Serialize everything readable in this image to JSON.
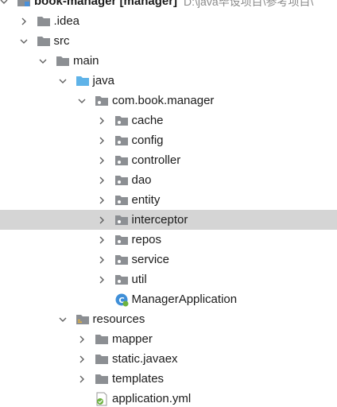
{
  "tree": {
    "rows": [
      {
        "label": "book-manager [manager]",
        "suffix": "D:\\java毕设项目\\参考项目\\",
        "level": 0,
        "arrow": "down",
        "icon": "module-icon",
        "bold": true
      },
      {
        "label": ".idea",
        "level": 1,
        "arrow": "right",
        "icon": "folder-icon"
      },
      {
        "label": "src",
        "level": 1,
        "arrow": "down",
        "icon": "folder-icon"
      },
      {
        "label": "main",
        "level": 2,
        "arrow": "down",
        "icon": "folder-icon"
      },
      {
        "label": "java",
        "level": 3,
        "arrow": "down",
        "icon": "source-folder-icon"
      },
      {
        "label": "com.book.manager",
        "level": 4,
        "arrow": "down",
        "icon": "package-icon"
      },
      {
        "label": "cache",
        "level": 5,
        "arrow": "right",
        "icon": "package-icon"
      },
      {
        "label": "config",
        "level": 5,
        "arrow": "right",
        "icon": "package-icon"
      },
      {
        "label": "controller",
        "level": 5,
        "arrow": "right",
        "icon": "package-icon"
      },
      {
        "label": "dao",
        "level": 5,
        "arrow": "right",
        "icon": "package-icon"
      },
      {
        "label": "entity",
        "level": 5,
        "arrow": "right",
        "icon": "package-icon"
      },
      {
        "label": "interceptor",
        "level": 5,
        "arrow": "right",
        "icon": "package-icon",
        "selected": true
      },
      {
        "label": "repos",
        "level": 5,
        "arrow": "right",
        "icon": "package-icon"
      },
      {
        "label": "service",
        "level": 5,
        "arrow": "right",
        "icon": "package-icon"
      },
      {
        "label": "util",
        "level": 5,
        "arrow": "right",
        "icon": "package-icon"
      },
      {
        "label": "ManagerApplication",
        "level": 5,
        "arrow": "none",
        "icon": "spring-class-icon"
      },
      {
        "label": "resources",
        "level": 3,
        "arrow": "down",
        "icon": "resources-folder-icon"
      },
      {
        "label": "mapper",
        "level": 4,
        "arrow": "right",
        "icon": "folder-icon"
      },
      {
        "label": "static.javaex",
        "level": 4,
        "arrow": "right",
        "icon": "folder-icon"
      },
      {
        "label": "templates",
        "level": 4,
        "arrow": "right",
        "icon": "folder-icon"
      },
      {
        "label": "application.yml",
        "level": 4,
        "arrow": "none",
        "icon": "yml-file-icon"
      }
    ]
  },
  "colors": {
    "folder": "#8c8f93",
    "source_folder": "#5fb3e8",
    "selection": "#d5d5d5",
    "arrow": "#606060",
    "spring": "#6db33f",
    "module": "#4a90d9"
  }
}
